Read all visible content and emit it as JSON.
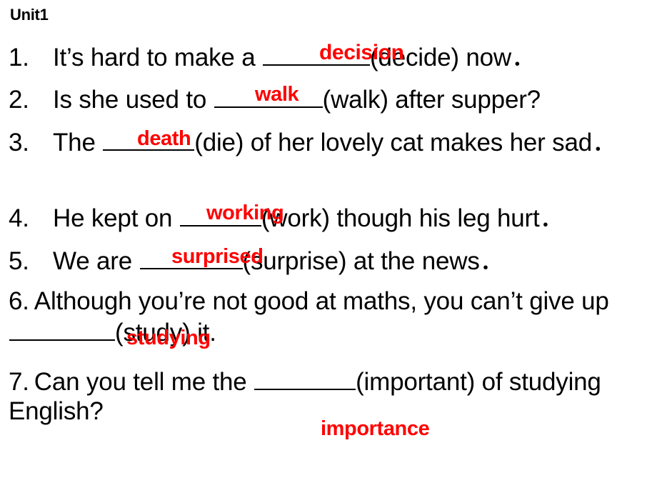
{
  "slide": {
    "title": "Unit1",
    "background_color": "#FFFFFF",
    "text_color": "#000000",
    "answer_color": "#FF0000"
  },
  "questions": [
    {
      "number": "1.",
      "before": "It’s hard to make a ",
      "after": "(decide) now．",
      "cue": "decide",
      "answer": "decision"
    },
    {
      "number": "2.",
      "before": "Is she used to ",
      "after": "(walk) after supper?",
      "cue": "walk",
      "answer": "walk"
    },
    {
      "number": "3.",
      "before": "The ",
      "after": "(die) of her lovely cat makes her sad．",
      "cue": "die",
      "answer": "death"
    },
    {
      "number": "4.",
      "before": "He kept on ",
      "after": "(work) though his leg hurt．",
      "cue": "work",
      "answer": "working"
    },
    {
      "number": "5.",
      "before": "We are ",
      "after": "(surprise) at the news．",
      "cue": "surprise",
      "answer": "surprised"
    },
    {
      "number": "6.",
      "before": "Although you’re not good at maths, you can’t give up ",
      "after": "(study) it.",
      "cue": "study",
      "answer": "studying"
    },
    {
      "number": "7.",
      "before": "Can you tell me the ",
      "after": "(important) of studying English?",
      "cue": "important",
      "answer": "importance"
    }
  ],
  "answers_overlay": [
    {
      "label": "decision",
      "for_question": "1"
    },
    {
      "label": "walk",
      "for_question": "2"
    },
    {
      "label": "death",
      "for_question": "3"
    },
    {
      "label": "working",
      "for_question": "4"
    },
    {
      "label": "surprised",
      "for_question": "5"
    },
    {
      "label": "studying",
      "for_question": "6"
    },
    {
      "label": "importance",
      "for_question": "7"
    }
  ]
}
